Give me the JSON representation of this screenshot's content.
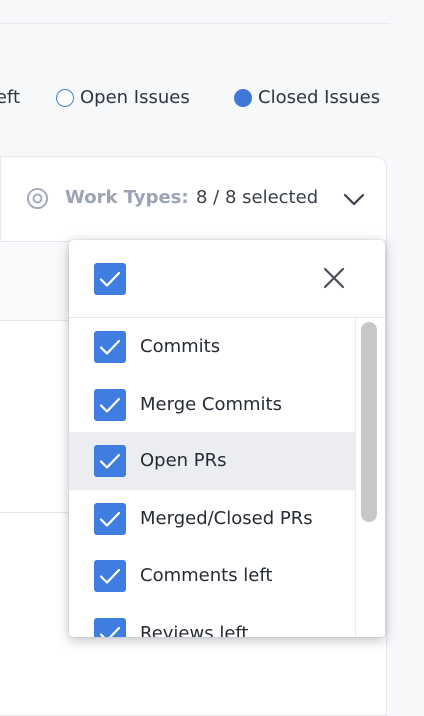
{
  "legend": {
    "partial_label": "eft",
    "open_issues_label": "Open Issues",
    "closed_issues_label": "Closed Issues"
  },
  "filter": {
    "icon": "filter-circle-icon",
    "label": "Work Types:",
    "count": "8 / 8 selected",
    "chevron_icon": "chevron-down-icon"
  },
  "dropdown": {
    "select_all_checked": true,
    "close_icon": "close-icon",
    "items": [
      {
        "label": "Commits",
        "checked": true
      },
      {
        "label": "Merge Commits",
        "checked": true
      },
      {
        "label": "Open PRs",
        "checked": true,
        "highlighted": true
      },
      {
        "label": "Merged/Closed PRs",
        "checked": true
      },
      {
        "label": "Comments left",
        "checked": true
      },
      {
        "label": "Reviews left",
        "checked": true
      }
    ]
  },
  "colors": {
    "accent": "#3f7ee0",
    "label_muted": "#9ba3b4",
    "highlight_row": "#ecedf0"
  }
}
